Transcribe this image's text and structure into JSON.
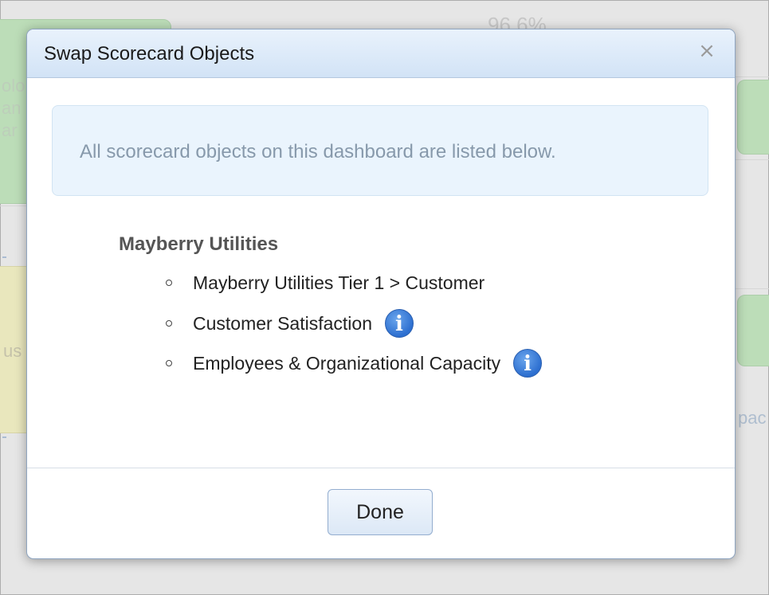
{
  "background": {
    "top_number": "96.6%",
    "left_fragments": [
      "olo",
      "an",
      "ar"
    ],
    "left_fragment_2": "us",
    "right_fragment": "pac"
  },
  "dialog": {
    "title": "Swap Scorecard Objects",
    "close_glyph": "×",
    "info_message": "All scorecard objects on this dashboard are listed below.",
    "group_title": "Mayberry Utilities",
    "items": [
      {
        "label": "Mayberry Utilities Tier 1 > Customer",
        "has_info": false
      },
      {
        "label": "Customer Satisfaction",
        "has_info": true
      },
      {
        "label": "Employees & Organizational Capacity",
        "has_info": true
      }
    ],
    "info_icon_glyph": "i",
    "done_label": "Done"
  }
}
